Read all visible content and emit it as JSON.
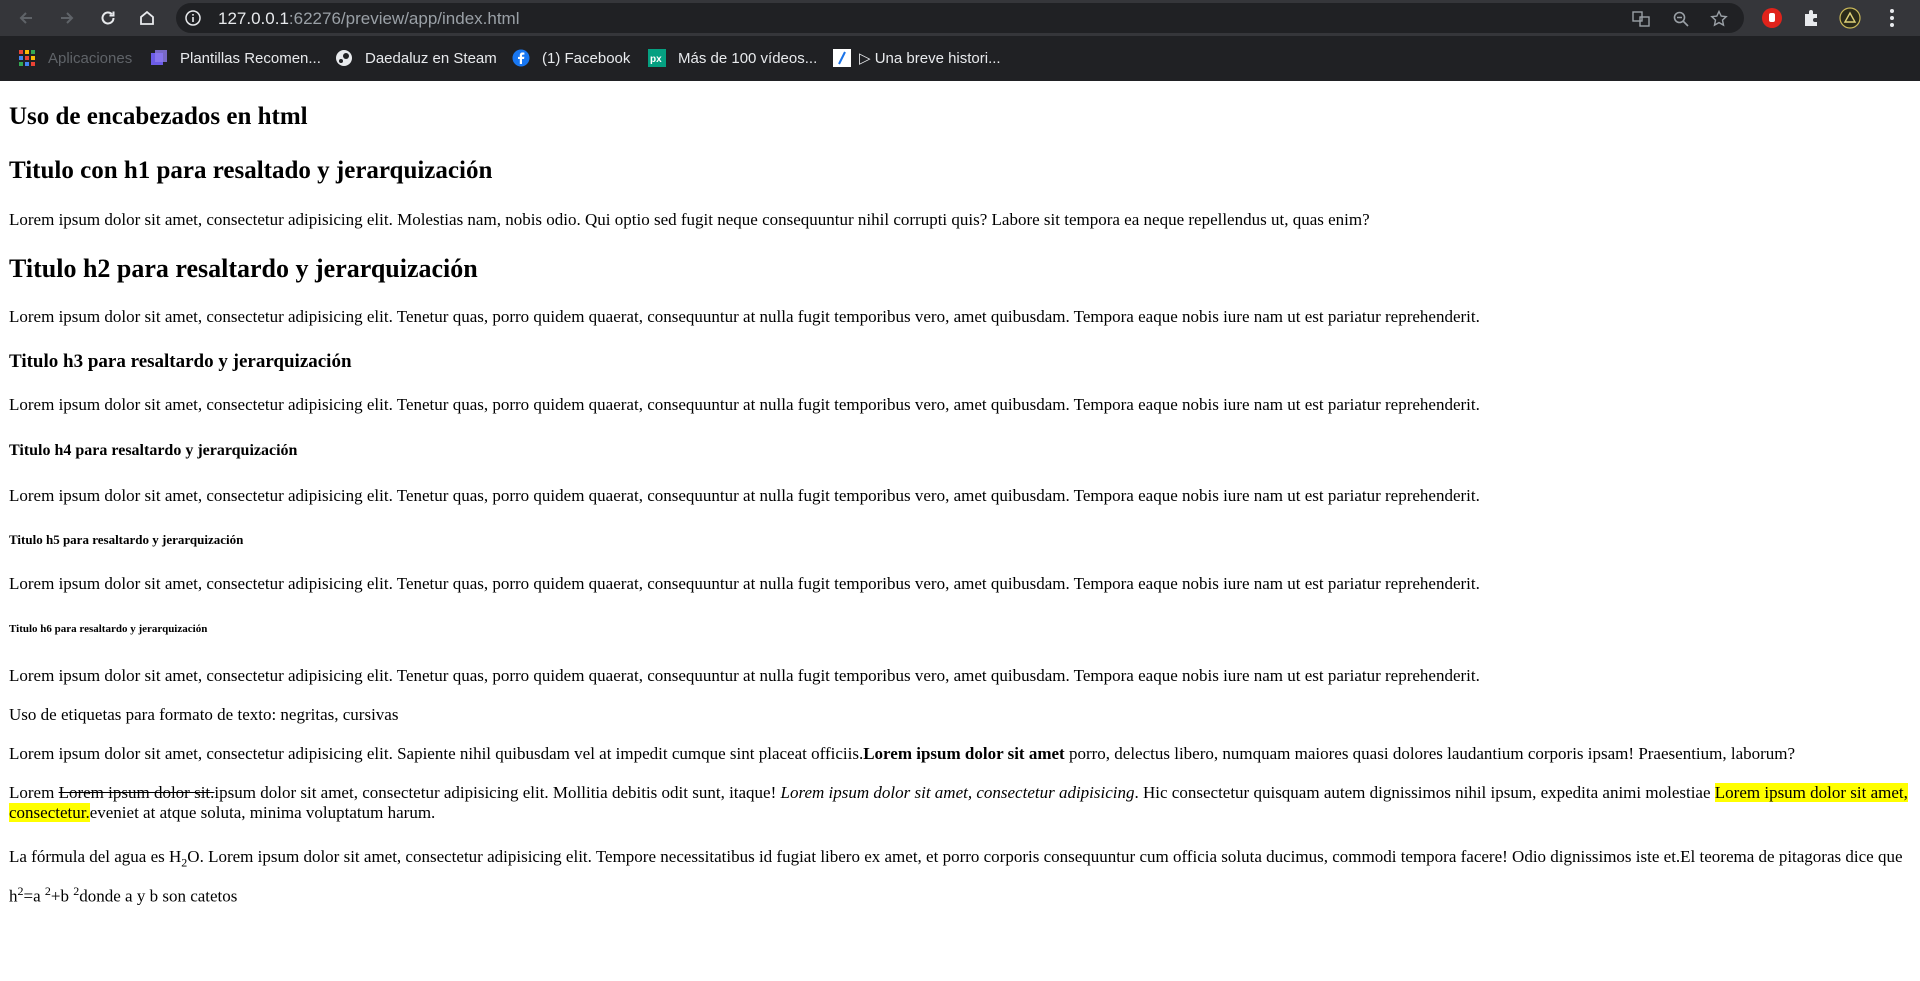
{
  "browser": {
    "url_host": "127.0.0.1",
    "url_rest": ":62276/preview/app/index.html",
    "bookmarks": [
      {
        "label": "Aplicaciones",
        "icon": "apps-grid-icon"
      },
      {
        "label": "Plantillas Recomen...",
        "icon": "template-icon"
      },
      {
        "label": "Daedaluz en Steam",
        "icon": "steam-icon"
      },
      {
        "label": "(1) Facebook",
        "icon": "facebook-icon"
      },
      {
        "label": "Más de 100 vídeos...",
        "icon": "pexels-icon"
      },
      {
        "label": "▷ Una breve histori...",
        "icon": "bookmark-page-icon"
      }
    ]
  },
  "page": {
    "title": "Uso de encabezados en html",
    "h1": "Titulo con h1 para resaltado y jerarquización",
    "p1": "Lorem ipsum dolor sit amet, consectetur adipisicing elit. Molestias nam, nobis odio. Qui optio sed fugit neque consequuntur nihil corrupti quis? Labore sit tempora ea neque repellendus ut, quas enim?",
    "h2": "Titulo h2 para resaltardo y jerarquización",
    "p2": "Lorem ipsum dolor sit amet, consectetur adipisicing elit. Tenetur quas, porro quidem quaerat, consequuntur at nulla fugit temporibus vero, amet quibusdam. Tempora eaque nobis iure nam ut est pariatur reprehenderit.",
    "h3": "Titulo h3 para resaltardo y jerarquización",
    "p3": "Lorem ipsum dolor sit amet, consectetur adipisicing elit. Tenetur quas, porro quidem quaerat, consequuntur at nulla fugit temporibus vero, amet quibusdam. Tempora eaque nobis iure nam ut est pariatur reprehenderit.",
    "h4": "Titulo h4 para resaltardo y jerarquización",
    "p4": "Lorem ipsum dolor sit amet, consectetur adipisicing elit. Tenetur quas, porro quidem quaerat, consequuntur at nulla fugit temporibus vero, amet quibusdam. Tempora eaque nobis iure nam ut est pariatur reprehenderit.",
    "h5": "Titulo h5 para resaltardo y jerarquización",
    "p5": "Lorem ipsum dolor sit amet, consectetur adipisicing elit. Tenetur quas, porro quidem quaerat, consequuntur at nulla fugit temporibus vero, amet quibusdam. Tempora eaque nobis iure nam ut est pariatur reprehenderit.",
    "h6": "Titulo h6 para resaltardo y jerarquización",
    "p6": "Lorem ipsum dolor sit amet, consectetur adipisicing elit. Tenetur quas, porro quidem quaerat, consequuntur at nulla fugit temporibus vero, amet quibusdam. Tempora eaque nobis iure nam ut est pariatur reprehenderit.",
    "p7": "Uso de etiquetas para formato de texto: negritas, cursivas",
    "p8_a": "Lorem ipsum dolor sit amet, consectetur adipisicing elit. Sapiente nihil quibusdam vel at impedit cumque sint placeat officiis.",
    "p8_bold": "Lorem ipsum dolor sit amet",
    "p8_b": " porro, delectus libero, numquam maiores quasi dolores laudantium corporis ipsam! Praesentium, laborum?",
    "p9_a": "Lorem ",
    "p9_strike": "Lorem ipsum dolor sit.",
    "p9_b": "ipsum dolor sit amet, consectetur adipisicing elit. Mollitia debitis odit sunt, itaque! ",
    "p9_italic": "Lorem ipsum dolor sit amet, consectetur adipisicing",
    "p9_c": ". Hic consectetur quisquam autem dignissimos nihil ipsum, expedita animi molestiae ",
    "p9_mark": "Lorem ipsum dolor sit amet, consectetur.",
    "p9_d": "eveniet at atque soluta, minima voluptatum harum.",
    "p10_a": "La fórmula del agua es H",
    "p10_sub": "2",
    "p10_b": "O. Lorem ipsum dolor sit amet, consectetur adipisicing elit. Tempore necessitatibus id fugiat libero ex amet, et porro corporis consequuntur cum officia soluta ducimus, commodi tempora facere! Odio dignissimos iste et.El teorema de pitagoras dice que h",
    "p10_sup1": "2",
    "p10_c": "=a ",
    "p10_sup2": "2",
    "p10_d": "+b ",
    "p10_sup3": "2",
    "p10_e": "donde a y b son catetos"
  }
}
